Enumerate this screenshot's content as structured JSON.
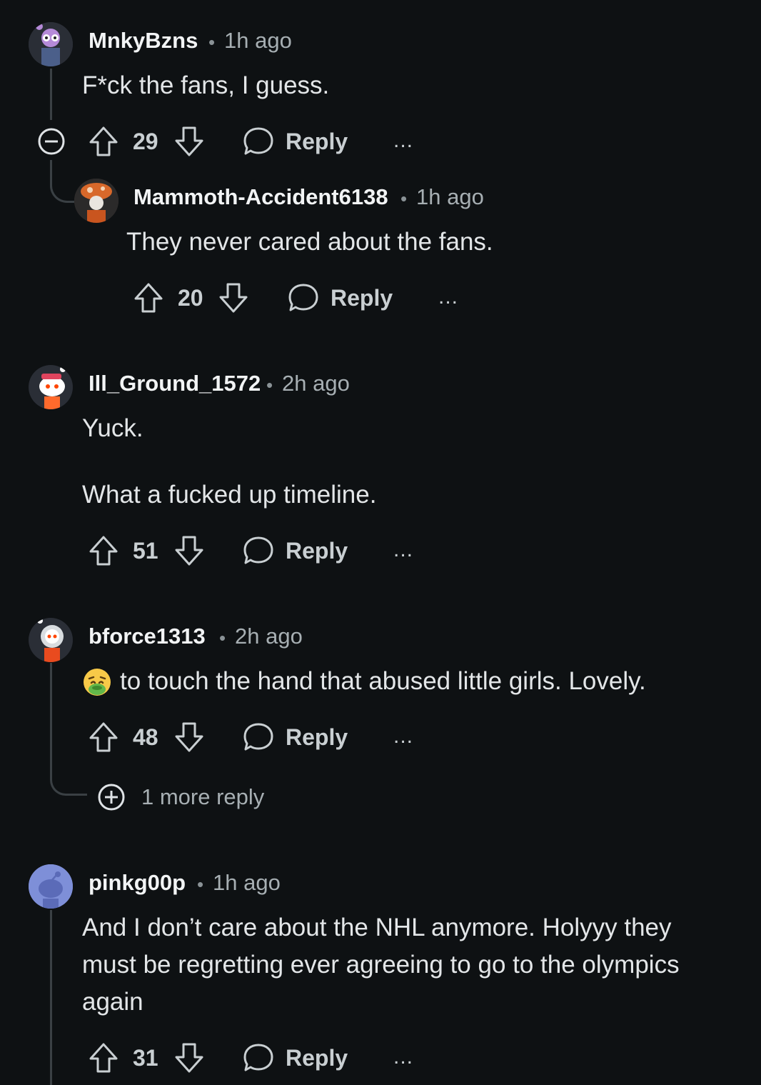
{
  "comments": [
    {
      "user": "MnkyBzns",
      "time": "1h ago",
      "text": [
        "F*ck the fans, I guess."
      ],
      "score": "29",
      "reply": "Reply",
      "more": "..."
    },
    {
      "user": "Mammoth-Accident6138",
      "time": "1h ago",
      "text": [
        "They never cared about the fans."
      ],
      "score": "20",
      "reply": "Reply",
      "more": "..."
    },
    {
      "user": "Ill_Ground_1572",
      "time": "2h ago",
      "text": [
        "Yuck.",
        "What a fucked up timeline."
      ],
      "score": "51",
      "reply": "Reply",
      "more": "..."
    },
    {
      "user": "bforce1313",
      "time": "2h ago",
      "text": [
        "to touch the hand that abused little girls. Lovely."
      ],
      "score": "48",
      "reply": "Reply",
      "more": "...",
      "more_replies": "1 more reply"
    },
    {
      "user": "pinkg00p",
      "time": "1h ago",
      "text": [
        "And I don’t care about the NHL anymore. Holyyy they",
        "must be regretting ever agreeing to go to the olympics",
        "again"
      ],
      "score": "31",
      "reply": "Reply",
      "more": "..."
    }
  ],
  "separator": "•",
  "icons": {
    "upvote": "upvote-icon",
    "downvote": "downvote-icon",
    "reply": "speech-bubble-icon",
    "collapse": "minus-circle-icon",
    "expand": "plus-circle-icon",
    "emoji": "nauseated-face-emoji"
  }
}
